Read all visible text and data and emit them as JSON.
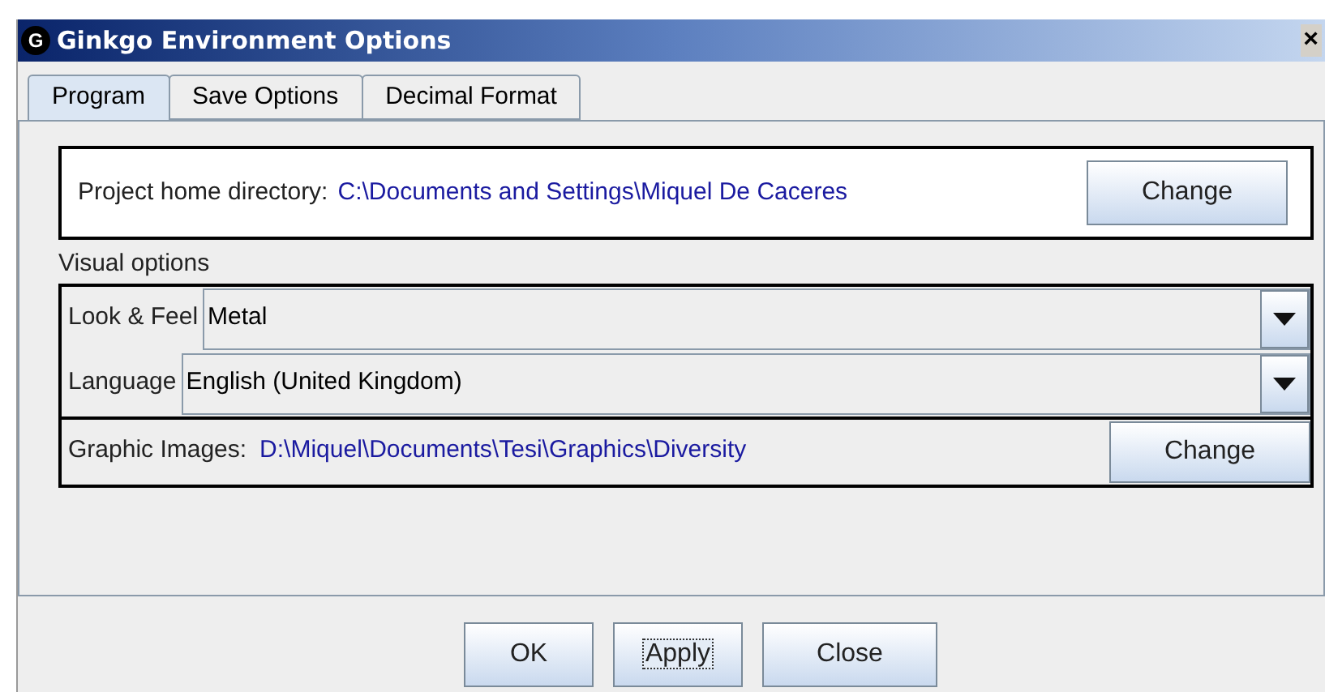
{
  "window": {
    "title": "Ginkgo Environment Options",
    "logo": "G",
    "close": "×"
  },
  "tabs": [
    {
      "label": "Program",
      "selected": true
    },
    {
      "label": "Save Options",
      "selected": false
    },
    {
      "label": "Decimal Format",
      "selected": false
    }
  ],
  "project_home": {
    "label": "Project home directory:",
    "path": "C:\\Documents and Settings\\Miquel De Caceres",
    "button": "Change"
  },
  "visual_options": {
    "title": "Visual options",
    "combos": [
      {
        "label": "Look & Feel",
        "value": "Metal"
      },
      {
        "label": "Language",
        "value": "English (United Kingdom)"
      }
    ]
  },
  "graphic_images": {
    "label": "Graphic Images:",
    "path": "D:\\Miquel\\Documents\\Tesi\\Graphics\\Diversity",
    "button": "Change"
  },
  "buttons": [
    {
      "label": "OK",
      "focused": false
    },
    {
      "label": "Apply",
      "focused": true
    },
    {
      "label": "Close",
      "focused": false
    }
  ]
}
